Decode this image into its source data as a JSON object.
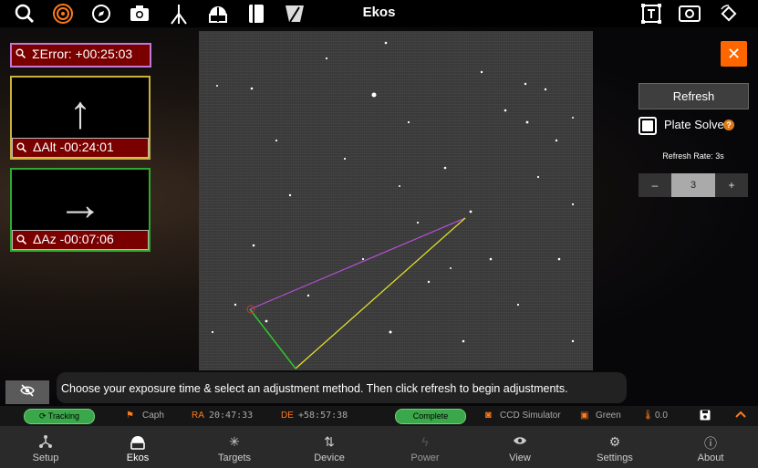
{
  "app": {
    "title": "Ekos"
  },
  "toolbar": {
    "icons": [
      "search-icon",
      "target-icon",
      "compass-icon",
      "camera-icon",
      "mount-icon",
      "observatory-icon",
      "notebook-icon",
      "flip-icon",
      "crop-icon",
      "frame-icon",
      "rotate-icon"
    ]
  },
  "alignment": {
    "error_label": "ΣError: +00:25:03",
    "alt_label": "ΔAlt -00:24:01",
    "az_label": "ΔAz -00:07:06",
    "alt_arrow": "↑",
    "az_arrow": "→"
  },
  "controls": {
    "close_label": "✕",
    "refresh_label": "Refresh",
    "plate_solve_label": "Plate Solve",
    "help_label": "?",
    "refresh_rate_label": "Refresh Rate: 3s",
    "stepper_minus": "–",
    "stepper_value": "3",
    "stepper_plus": "+"
  },
  "message": "Choose your exposure time & select an adjustment method. Then click refresh to begin adjustments.",
  "status": {
    "tracking": "Tracking",
    "target": "Caph",
    "ra_label": "RA",
    "ra_value": "20:47:33",
    "de_label": "DE",
    "de_value": "+58:57:38",
    "capture_status": "Complete",
    "camera": "CCD Simulator",
    "filter": "Green",
    "temperature": "0.0"
  },
  "nav": [
    {
      "label": "Setup",
      "icon": "setup-icon"
    },
    {
      "label": "Ekos",
      "icon": "ekos-icon"
    },
    {
      "label": "Targets",
      "icon": "targets-icon"
    },
    {
      "label": "Device",
      "icon": "device-icon"
    },
    {
      "label": "Power",
      "icon": "power-icon"
    },
    {
      "label": "View",
      "icon": "view-icon"
    },
    {
      "label": "Settings",
      "icon": "settings-icon"
    },
    {
      "label": "About",
      "icon": "about-icon"
    }
  ],
  "colors": {
    "accent": "#ff6600",
    "error_border": "#c079d6",
    "alt_border": "#c9b23c",
    "az_border": "#2eaa2e",
    "label_bg": "#7a0000",
    "line_purple": "#b44fd6",
    "line_yellow": "#e8e82a",
    "line_green": "#2ec82e"
  }
}
